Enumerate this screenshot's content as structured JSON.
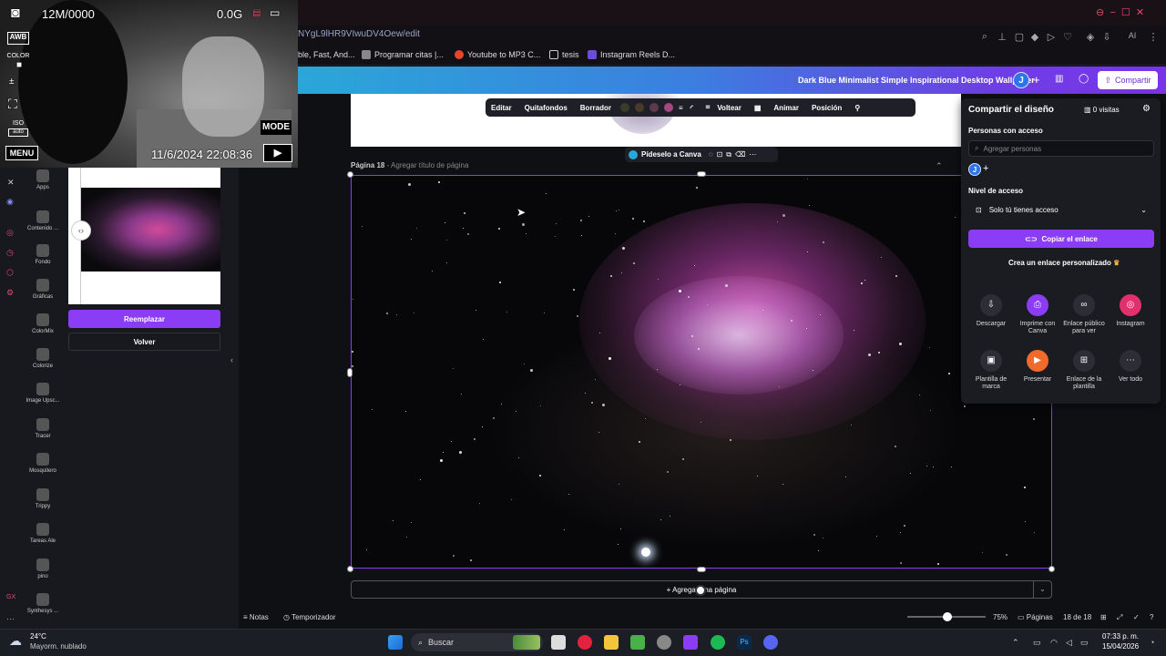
{
  "camera": {
    "storage": "12M/0000",
    "size": "0.0G",
    "awb": "AWB",
    "color": "COLOR",
    "iso": "ISO",
    "iso_value": "auto",
    "mode": "MODE",
    "menu": "MENU",
    "datetime": "11/6/2024 22:08:36"
  },
  "browser": {
    "url": "NYgL9lHR9VIwuDV4Oew/edit",
    "bookmarks": [
      "ble, Fast, And...",
      "Programar citas |...",
      "Youtube to MP3 C...",
      "tesis",
      "Instagram Reels D..."
    ]
  },
  "canva_header": {
    "design_title": "Dark Blue Minimalist Simple Inspirational Desktop Wallpaper",
    "avatar": "J",
    "share_label": "Compartir"
  },
  "rail": {
    "apps": [
      "Apps",
      "Contenido ...",
      "Fondo",
      "Gráficas",
      "ColorMix",
      "Colorize",
      "Image Upsc...",
      "Tracer",
      "Mosquitero",
      "Trippy",
      "Tareas Ale",
      "pino",
      "Synthesys ..."
    ]
  },
  "panel": {
    "replace": "Reemplazar",
    "back": "Volver"
  },
  "context_toolbar": {
    "items": [
      "Editar",
      "Quitafondos",
      "Borrador",
      "Voltear",
      "Animar",
      "Posición"
    ],
    "swatches": [
      "#3b3b2a",
      "#4a3a2a",
      "#5e3a4e",
      "#a2477f"
    ]
  },
  "page": {
    "ask_canva": "Pídeselo a Canva",
    "label": "Página 18",
    "title_placeholder": "- Agregar título de página",
    "add_page": "+ Agregar una página"
  },
  "bottom_bar": {
    "notes": "Notas",
    "timer": "Temporizador",
    "zoom": "75%",
    "zoom_level": 0.45,
    "pages": "Páginas",
    "page_count": "18 de 18"
  },
  "share_panel": {
    "title": "Compartir el diseño",
    "visits": "0 visitas",
    "people_with_access": "Personas con acceso",
    "add_people_placeholder": "Agregar personas",
    "avatar": "J",
    "access_level": "Nivel de acceso",
    "access_value": "Solo tú tienes acceso",
    "copy_link": "Copiar el enlace",
    "custom_link": "Crea un enlace personalizado",
    "options": [
      {
        "label": "Descargar",
        "color": "#2c2d35"
      },
      {
        "label": "Imprime con Canva",
        "color": "#8b3df6"
      },
      {
        "label": "Enlace público para ver",
        "color": "#2c2d35"
      },
      {
        "label": "Instagram",
        "color": "#e1306c"
      },
      {
        "label": "Plantilla de marca",
        "color": "#2c2d35"
      },
      {
        "label": "Presentar",
        "color": "#f06a2a"
      },
      {
        "label": "Enlace de la plantilla",
        "color": "#2c2d35"
      },
      {
        "label": "Ver todo",
        "color": "#2c2d35"
      }
    ]
  },
  "taskbar": {
    "temperature": "24°C",
    "weather": "Mayorm. nublado",
    "search": "Buscar",
    "time": "07:33 p. m.",
    "date": "15/04/2026"
  }
}
